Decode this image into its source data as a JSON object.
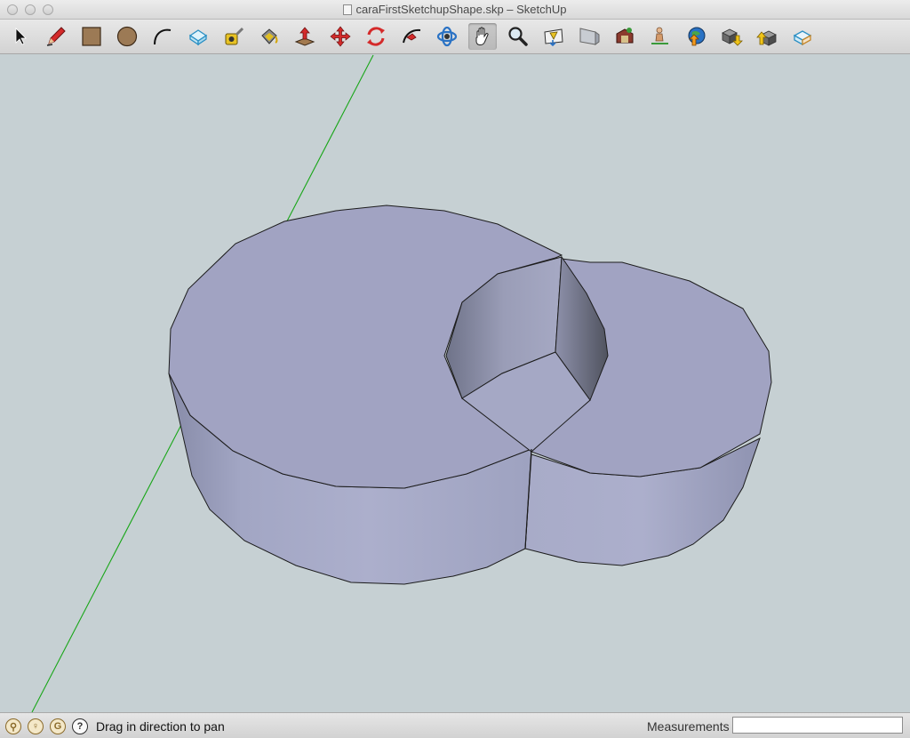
{
  "window": {
    "title": "caraFirstSketchupShape.skp – SketchUp"
  },
  "toolbar": {
    "tools": [
      {
        "name": "select-tool",
        "icon": "arrow-cursor-icon"
      },
      {
        "name": "pencil-tool",
        "icon": "pencil-icon"
      },
      {
        "name": "rectangle-tool",
        "icon": "rectangle-icon"
      },
      {
        "name": "circle-tool",
        "icon": "circle-icon"
      },
      {
        "name": "arc-tool",
        "icon": "arc-icon"
      },
      {
        "name": "make-component-tool",
        "icon": "component-icon"
      },
      {
        "name": "tape-measure-tool",
        "icon": "tape-measure-icon"
      },
      {
        "name": "paint-bucket-tool",
        "icon": "paint-bucket-icon"
      },
      {
        "name": "push-pull-tool",
        "icon": "push-pull-icon"
      },
      {
        "name": "move-tool",
        "icon": "move-arrows-icon"
      },
      {
        "name": "rotate-tool",
        "icon": "rotate-icon"
      },
      {
        "name": "follow-me-tool",
        "icon": "follow-me-icon"
      },
      {
        "name": "orbit-tool",
        "icon": "orbit-icon"
      },
      {
        "name": "pan-tool",
        "icon": "hand-icon"
      },
      {
        "name": "zoom-tool",
        "icon": "magnifier-icon"
      },
      {
        "name": "zoom-extents-tool",
        "icon": "zoom-extents-icon"
      },
      {
        "name": "previous-view-tool",
        "icon": "previous-view-icon"
      },
      {
        "name": "warehouse-tool",
        "icon": "warehouse-icon"
      },
      {
        "name": "position-camera-tool",
        "icon": "position-camera-icon"
      },
      {
        "name": "google-earth-tool",
        "icon": "earth-icon"
      },
      {
        "name": "get-models-tool",
        "icon": "get-models-icon"
      },
      {
        "name": "share-model-tool",
        "icon": "share-model-icon"
      },
      {
        "name": "extension-warehouse-tool",
        "icon": "extension-icon"
      }
    ],
    "active_tool": "pan-tool"
  },
  "statusbar": {
    "message": "Drag in direction to pan",
    "measurements_label": "Measurements",
    "measurements_value": "",
    "icons": [
      "geo-location-icon",
      "credits-icon",
      "google-signin-icon",
      "help-icon"
    ]
  },
  "colors": {
    "viewport_bg": "#c6d0d3",
    "face_top": "#a1a3c2",
    "face_side": "#a8abc8",
    "edge": "#1c1c1c",
    "green_axis": "#19a619"
  }
}
